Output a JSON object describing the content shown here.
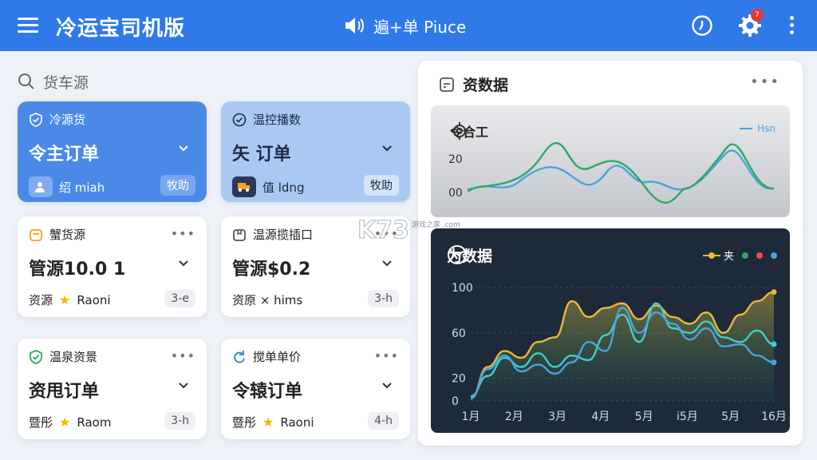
{
  "header": {
    "title": "冷运宝司机版",
    "center_text": "遍+单 Piuce",
    "notification_count": "7"
  },
  "search": {
    "placeholder": "货车源"
  },
  "cards": [
    {
      "title": "冷源货",
      "main": "令主订单",
      "foot": "绍 miah",
      "pill": "牧助"
    },
    {
      "title": "温控播数",
      "main": "矢 订单",
      "foot": "值 ldng",
      "pill": "牧助"
    },
    {
      "title": "蟹货源",
      "main": "管源10.0 1",
      "foot": "资源",
      "star_text": "Raoni",
      "pill": "3-e"
    },
    {
      "title": "温源揽插口",
      "main": "管源$0.2",
      "foot": "资原 × hims",
      "pill": "3-h"
    },
    {
      "title": "温泉资景",
      "main": "资甩订单",
      "foot": "暨彤",
      "star_text": "Raom",
      "pill": "3-h"
    },
    {
      "title": "搅单单价",
      "main": "令辕订单",
      "foot": "暨彤",
      "star_text": "Raoni",
      "pill": "4-h"
    }
  ],
  "panel": {
    "title": "资数据"
  },
  "chart_top": {
    "title": "令合工",
    "legend": "Hsn",
    "y_labels": [
      "20",
      "00"
    ]
  },
  "chart_data": {
    "type": "line",
    "title": "为数据",
    "legend_label": "夹",
    "categories": [
      "1月",
      "2月",
      "3月",
      "4月",
      "5月",
      "i5月",
      "5月",
      "16月"
    ],
    "ylim": [
      0,
      100
    ],
    "y_ticks": [
      "100",
      "60",
      "20",
      "0"
    ],
    "colors": {
      "gold": "#e8b93a",
      "teal": "#3fd0c8",
      "green": "#2ea86a",
      "red": "#e0555a",
      "blue": "#4aa3df"
    },
    "series": [
      {
        "values": [
          2,
          30,
          44,
          38,
          52,
          56,
          88,
          74,
          82,
          86,
          72,
          84,
          74,
          68,
          78,
          60,
          76,
          88,
          96
        ]
      },
      {
        "values": [
          4,
          22,
          38,
          30,
          42,
          30,
          40,
          36,
          58,
          76,
          52,
          86,
          64,
          60,
          70,
          56,
          52,
          62,
          50
        ]
      },
      {
        "values": [
          2,
          28,
          40,
          26,
          32,
          24,
          34,
          52,
          44,
          82,
          60,
          78,
          68,
          54,
          64,
          48,
          50,
          40,
          34
        ]
      }
    ]
  },
  "watermark": {
    "text": "K73",
    "sub": "游戏之家 .com"
  }
}
